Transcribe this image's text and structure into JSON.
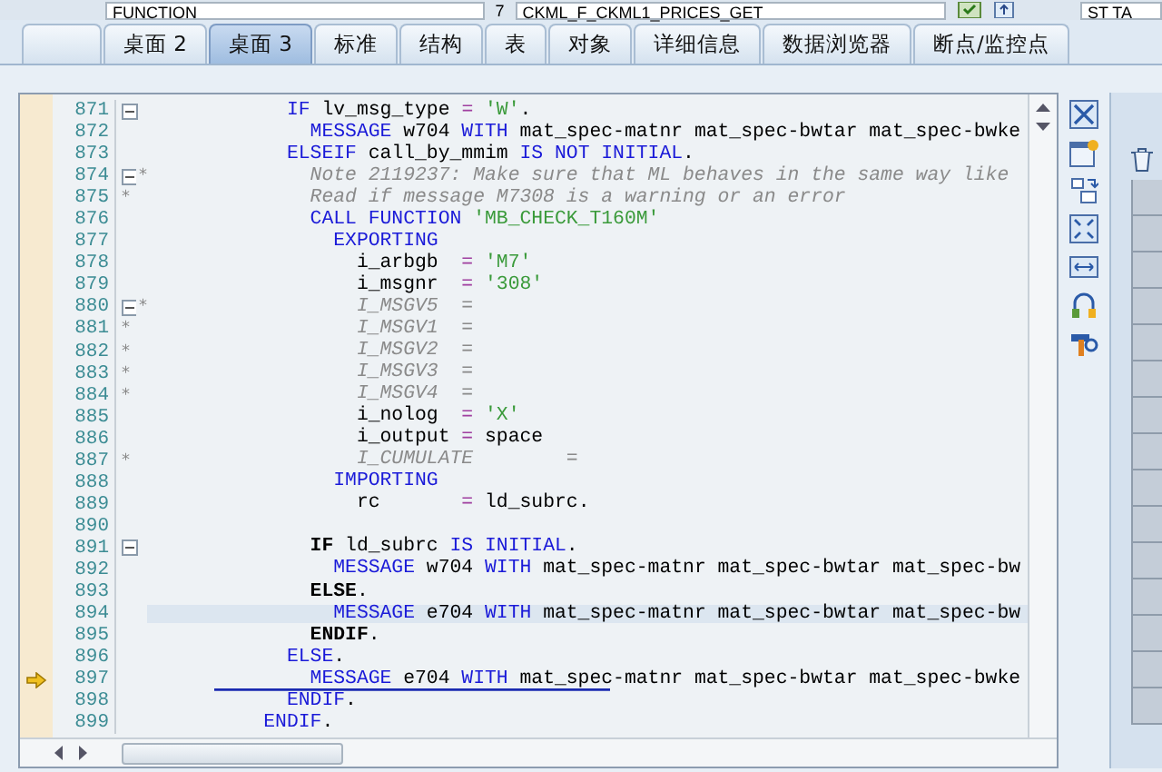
{
  "top_bar": {
    "type_field": "FUNCTION",
    "separator": "7",
    "name_field": "CKML_F_CKML1_PRICES_GET",
    "right_field": "ST TA"
  },
  "tabs": [
    {
      "selected": false
    },
    {
      "label": "桌面 2",
      "selected": false
    },
    {
      "label": "桌面 3",
      "selected": true
    },
    {
      "label": "标准",
      "selected": false
    },
    {
      "label": "结构",
      "selected": false
    },
    {
      "label": "表",
      "selected": false
    },
    {
      "label": "对象",
      "selected": false
    },
    {
      "label": "详细信息",
      "selected": false
    },
    {
      "label": "数据浏览器",
      "selected": false
    },
    {
      "label": "断点/监控点",
      "selected": false
    }
  ],
  "editor": {
    "lines": [
      {
        "num": "871",
        "fold_open": true,
        "highlighted": false,
        "current": false,
        "tokens": [
          {
            "kind": "kw",
            "text": "            IF"
          },
          {
            "kind": "txt",
            "text": " lv_msg_type "
          },
          {
            "kind": "op",
            "text": "="
          },
          {
            "kind": "str",
            "text": " 'W'"
          },
          {
            "kind": "txt",
            "text": "."
          }
        ]
      },
      {
        "num": "872",
        "fold_open": false,
        "highlighted": false,
        "current": false,
        "tokens": [
          {
            "kind": "kw",
            "text": "              MESSAGE"
          },
          {
            "kind": "txt",
            "text": " w704 "
          },
          {
            "kind": "kw",
            "text": "WITH"
          },
          {
            "kind": "txt",
            "text": " mat_spec-matnr mat_spec-bwtar mat_spec-bwke"
          }
        ]
      },
      {
        "num": "873",
        "fold_open": false,
        "highlighted": false,
        "current": false,
        "tokens": [
          {
            "kind": "kw",
            "text": "            ELSEIF"
          },
          {
            "kind": "txt",
            "text": " call_by_mmim "
          },
          {
            "kind": "kw",
            "text": "IS NOT INITIAL"
          },
          {
            "kind": "txt",
            "text": "."
          }
        ]
      },
      {
        "num": "874",
        "fold_open": true,
        "marker": "*",
        "highlighted": false,
        "current": false,
        "tokens": [
          {
            "kind": "cmt",
            "text": "              Note 2119237: Make sure that ML behaves in the same way like"
          }
        ]
      },
      {
        "num": "875",
        "fold_open": false,
        "marker": "*",
        "highlighted": false,
        "current": false,
        "tokens": [
          {
            "kind": "cmt",
            "text": "              Read if message M7308 is a warning or an error"
          }
        ]
      },
      {
        "num": "876",
        "fold_open": false,
        "highlighted": false,
        "current": false,
        "tokens": [
          {
            "kind": "kw",
            "text": "              CALL FUNCTION"
          },
          {
            "kind": "str",
            "text": " 'MB_CHECK_T160M'"
          }
        ]
      },
      {
        "num": "877",
        "fold_open": false,
        "highlighted": false,
        "current": false,
        "tokens": [
          {
            "kind": "kw",
            "text": "                EXPORTING"
          }
        ]
      },
      {
        "num": "878",
        "fold_open": false,
        "highlighted": false,
        "current": false,
        "tokens": [
          {
            "kind": "txt",
            "text": "                  i_arbgb  "
          },
          {
            "kind": "op",
            "text": "="
          },
          {
            "kind": "str",
            "text": " 'M7'"
          }
        ]
      },
      {
        "num": "879",
        "fold_open": false,
        "highlighted": false,
        "current": false,
        "tokens": [
          {
            "kind": "txt",
            "text": "                  i_msgnr  "
          },
          {
            "kind": "op",
            "text": "="
          },
          {
            "kind": "str",
            "text": " '308'"
          }
        ]
      },
      {
        "num": "880",
        "fold_open": true,
        "marker": "*",
        "highlighted": false,
        "current": false,
        "tokens": [
          {
            "kind": "cmt",
            "text": "                  I_MSGV5  ="
          }
        ]
      },
      {
        "num": "881",
        "fold_open": false,
        "marker": "*",
        "highlighted": false,
        "current": false,
        "tokens": [
          {
            "kind": "cmt",
            "text": "                  I_MSGV1  ="
          }
        ]
      },
      {
        "num": "882",
        "fold_open": false,
        "marker": "*",
        "highlighted": false,
        "current": false,
        "tokens": [
          {
            "kind": "cmt",
            "text": "                  I_MSGV2  ="
          }
        ]
      },
      {
        "num": "883",
        "fold_open": false,
        "marker": "*",
        "highlighted": false,
        "current": false,
        "tokens": [
          {
            "kind": "cmt",
            "text": "                  I_MSGV3  ="
          }
        ]
      },
      {
        "num": "884",
        "fold_open": false,
        "marker": "*",
        "highlighted": false,
        "current": false,
        "tokens": [
          {
            "kind": "cmt",
            "text": "                  I_MSGV4  ="
          }
        ]
      },
      {
        "num": "885",
        "fold_open": false,
        "highlighted": false,
        "current": false,
        "tokens": [
          {
            "kind": "txt",
            "text": "                  i_nolog  "
          },
          {
            "kind": "op",
            "text": "="
          },
          {
            "kind": "str",
            "text": " 'X'"
          }
        ]
      },
      {
        "num": "886",
        "fold_open": false,
        "highlighted": false,
        "current": false,
        "tokens": [
          {
            "kind": "txt",
            "text": "                  i_output "
          },
          {
            "kind": "op",
            "text": "="
          },
          {
            "kind": "txt",
            "text": " space"
          }
        ]
      },
      {
        "num": "887",
        "fold_open": false,
        "marker": "*",
        "highlighted": false,
        "current": false,
        "tokens": [
          {
            "kind": "cmt",
            "text": "                  I_CUMULATE        ="
          }
        ]
      },
      {
        "num": "888",
        "fold_open": false,
        "highlighted": false,
        "current": false,
        "tokens": [
          {
            "kind": "kw",
            "text": "                IMPORTING"
          }
        ]
      },
      {
        "num": "889",
        "fold_open": false,
        "highlighted": false,
        "current": false,
        "tokens": [
          {
            "kind": "txt",
            "text": "                  rc       "
          },
          {
            "kind": "op",
            "text": "="
          },
          {
            "kind": "txt",
            "text": " ld_subrc."
          }
        ]
      },
      {
        "num": "890",
        "fold_open": false,
        "highlighted": false,
        "current": false
      },
      {
        "num": "891",
        "fold_open": true,
        "highlighted": false,
        "current": false,
        "tokens": [
          {
            "kind": "kwb",
            "text": "              IF"
          },
          {
            "kind": "txt",
            "text": " ld_subrc "
          },
          {
            "kind": "kw",
            "text": "IS INITIAL"
          },
          {
            "kind": "txt",
            "text": "."
          }
        ]
      },
      {
        "num": "892",
        "fold_open": false,
        "highlighted": false,
        "current": false,
        "tokens": [
          {
            "kind": "kw",
            "text": "                MESSAGE"
          },
          {
            "kind": "txt",
            "text": " w704 "
          },
          {
            "kind": "kw",
            "text": "WITH"
          },
          {
            "kind": "txt",
            "text": " mat_spec-matnr mat_spec-bwtar mat_spec-bw"
          }
        ]
      },
      {
        "num": "893",
        "fold_open": false,
        "highlighted": false,
        "current": false,
        "tokens": [
          {
            "kind": "kwb",
            "text": "              ELSE"
          },
          {
            "kind": "txt",
            "text": "."
          }
        ]
      },
      {
        "num": "894",
        "fold_open": false,
        "highlighted": true,
        "current": false,
        "tokens": [
          {
            "kind": "kw",
            "text": "                MESSAGE"
          },
          {
            "kind": "txt",
            "text": " e704 "
          },
          {
            "kind": "kw",
            "text": "WITH"
          },
          {
            "kind": "txt",
            "text": " mat_spec-matnr mat_spec-bwtar mat_spec-bw"
          }
        ]
      },
      {
        "num": "895",
        "fold_open": false,
        "highlighted": false,
        "current": false,
        "tokens": [
          {
            "kind": "kwb",
            "text": "              ENDIF"
          },
          {
            "kind": "txt",
            "text": "."
          }
        ]
      },
      {
        "num": "896",
        "fold_open": false,
        "highlighted": false,
        "current": false,
        "tokens": [
          {
            "kind": "kw",
            "text": "            ELSE"
          },
          {
            "kind": "txt",
            "text": "."
          }
        ]
      },
      {
        "num": "897",
        "fold_open": false,
        "highlighted": false,
        "current": true,
        "tokens": [
          {
            "kind": "kw",
            "text": "              MESSAGE"
          },
          {
            "kind": "txt",
            "text": " e704 "
          },
          {
            "kind": "kw",
            "text": "WITH"
          },
          {
            "kind": "txt",
            "text": " mat_spec-matnr mat_spec-bwtar mat_spec-bwke"
          }
        ]
      },
      {
        "num": "898",
        "fold_open": false,
        "highlighted": false,
        "current": false,
        "tokens": [
          {
            "kind": "kw",
            "text": "            ENDIF"
          },
          {
            "kind": "txt",
            "text": "."
          }
        ]
      },
      {
        "num": "899",
        "fold_open": false,
        "highlighted": false,
        "current": false,
        "tokens": [
          {
            "kind": "kw",
            "text": "          ENDIF"
          },
          {
            "kind": "txt",
            "text": "."
          }
        ]
      }
    ]
  }
}
